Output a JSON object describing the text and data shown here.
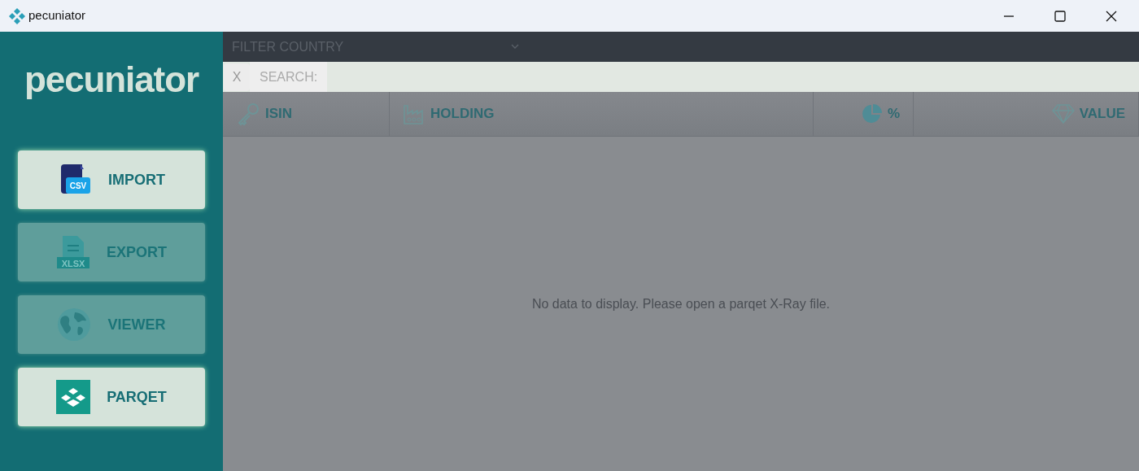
{
  "window": {
    "title": "pecuniator"
  },
  "sidebar": {
    "logo": "pecuniator",
    "buttons": [
      {
        "label": "IMPORT",
        "kind": "csv",
        "icon_text": "CSV",
        "disabled": false
      },
      {
        "label": "EXPORT",
        "kind": "xlsx",
        "icon_text": "XLSX",
        "disabled": true
      },
      {
        "label": "VIEWER",
        "kind": "globe",
        "disabled": true
      },
      {
        "label": "PARQET",
        "kind": "parqet",
        "disabled": false
      }
    ]
  },
  "filter": {
    "placeholder": "FILTER COUNTRY"
  },
  "search": {
    "clear": "X",
    "label": "SEARCH:"
  },
  "table": {
    "columns": [
      {
        "label": "ISIN",
        "kind": "key"
      },
      {
        "label": "HOLDING",
        "kind": "factory"
      },
      {
        "label": "%",
        "kind": "pie"
      },
      {
        "label": "VALUE",
        "kind": "diamond"
      }
    ],
    "empty_message": "No data to display. Please open a parqet X-Ray file."
  }
}
